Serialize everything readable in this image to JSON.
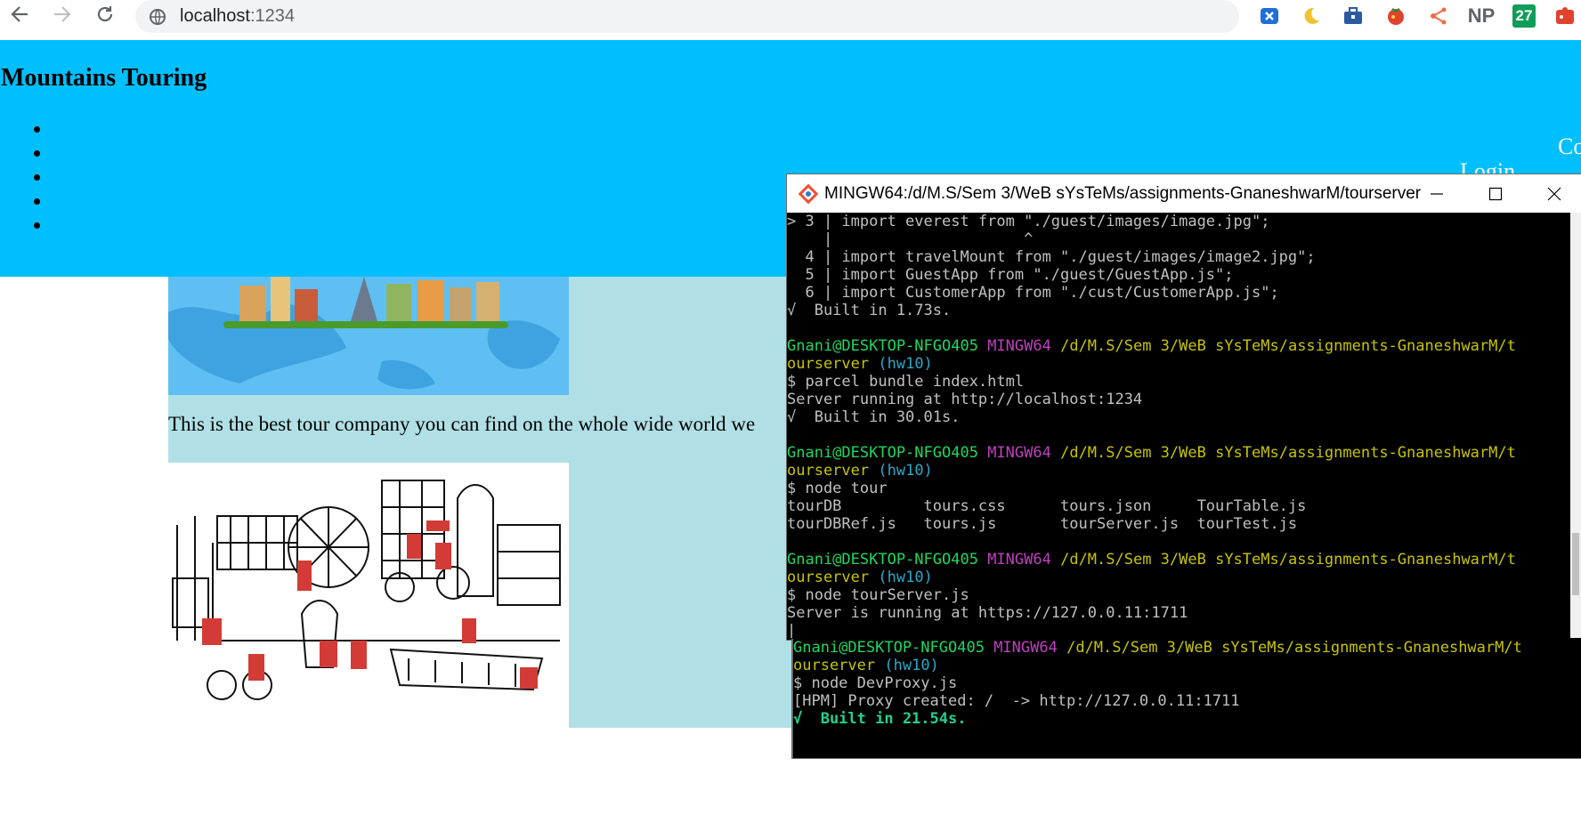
{
  "browser": {
    "url_host": "localhost",
    "url_port": ":1234",
    "extensions": [
      "close-tab-ext-icon",
      "moon-ext-icon",
      "toolbox-ext-icon",
      "tomato-ext-icon",
      "share-ext-icon",
      "np-ext-icon",
      "calendar-ext-icon",
      "puzzle-ext-icon"
    ],
    "ext_np_label": "NP",
    "ext_calendar_label": "27"
  },
  "page": {
    "title": "Mountains Touring",
    "nav_item_count": 5,
    "nav_contact_partial": "Co",
    "nav_login_partial": "Login",
    "tagline": "This is the best tour company you can find on the whole wide world we",
    "colors": {
      "header_bg": "#00bfff",
      "content_bg": "#b0e0e6"
    }
  },
  "terminal": {
    "title": "MINGW64:/d/M.S/Sem 3/WeB sYsTeMs/assignments-GnaneshwarM/tourserver",
    "lines": [
      {
        "t": "> 3 | import everest from \"./guest/images/image.jpg\";"
      },
      {
        "t": "    |                     ^"
      },
      {
        "t": "  4 | import travelMount from \"./guest/images/image2.jpg\";"
      },
      {
        "t": "  5 | import GuestApp from \"./guest/GuestApp.js\";"
      },
      {
        "t": "  6 | import CustomerApp from \"./cust/CustomerApp.js\";"
      },
      {
        "t": "√  Built in 1.73s."
      },
      {
        "t": ""
      },
      {
        "prompt": true,
        "user": "Gnani@DESKTOP-NFGO405",
        "env": "MINGW64",
        "path": "/d/M.S/Sem 3/WeB sYsTeMs/assignments-GnaneshwarM/t"
      },
      {
        "cont": "ourserver",
        "branch": "(hw10)"
      },
      {
        "t": "$ parcel bundle index.html"
      },
      {
        "t": "Server running at http://localhost:1234"
      },
      {
        "t": "√  Built in 30.01s."
      },
      {
        "t": ""
      },
      {
        "prompt": true,
        "user": "Gnani@DESKTOP-NFGO405",
        "env": "MINGW64",
        "path": "/d/M.S/Sem 3/WeB sYsTeMs/assignments-GnaneshwarM/t"
      },
      {
        "cont": "ourserver",
        "branch": "(hw10)"
      },
      {
        "t": "$ node tour"
      },
      {
        "t": "tourDB         tours.css      tours.json     TourTable.js"
      },
      {
        "t": "tourDBRef.js   tours.js       tourServer.js  tourTest.js"
      },
      {
        "t": ""
      },
      {
        "prompt": true,
        "user": "Gnani@DESKTOP-NFGO405",
        "env": "MINGW64",
        "path": "/d/M.S/Sem 3/WeB sYsTeMs/assignments-GnaneshwarM/t"
      },
      {
        "cont": "ourserver",
        "branch": "(hw10)"
      },
      {
        "t": "$ node tourServer.js"
      },
      {
        "t": "Server is running at https://127.0.0.11:1711"
      },
      {
        "t": "|"
      }
    ],
    "pane2": [
      {
        "prompt": true,
        "user": "Gnani@DESKTOP-NFGO405",
        "env": "MINGW64",
        "path": "/d/M.S/Sem 3/WeB sYsTeMs/assignments-GnaneshwarM/t"
      },
      {
        "cont": "ourserver",
        "branch": "(hw10)"
      },
      {
        "t": "$ node DevProxy.js"
      },
      {
        "t": "[HPM] Proxy created: /  -> http://127.0.0.11:1711"
      },
      {
        "t": "√  Built in 21.54s.",
        "cls": "c-bgreen"
      }
    ]
  }
}
